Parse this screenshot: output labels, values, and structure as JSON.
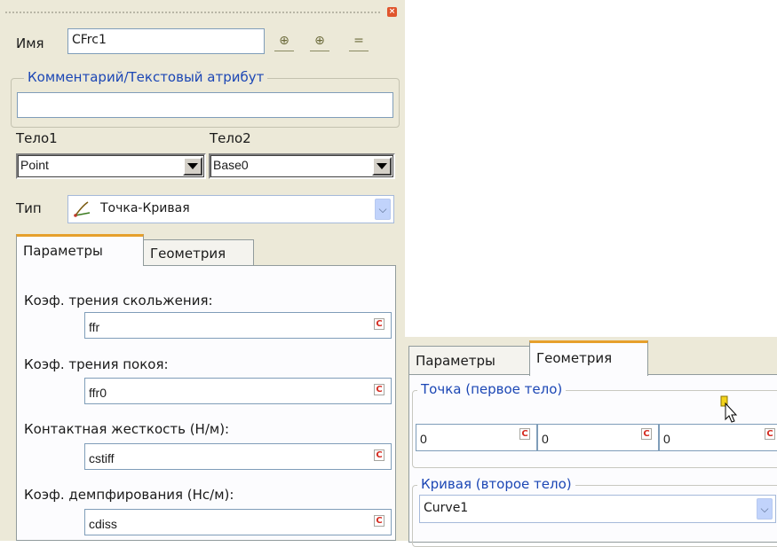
{
  "left": {
    "name_label": "Имя",
    "name_value": "CFrc1",
    "toolbar": [
      "-1-",
      "-1-",
      "-1-"
    ],
    "comment_group": "Комментарий/Текстовый атрибут",
    "comment_value": "",
    "body1_label": "Тело1",
    "body2_label": "Тело2",
    "body1_value": "Point",
    "body2_value": "Base0",
    "type_label": "Тип",
    "type_value": "Точка-Кривая",
    "tabs": {
      "params": "Параметры",
      "geometry": "Геометрия"
    },
    "fields": [
      {
        "label": "Коэф. трения скольжения:",
        "value": "ffr",
        "c": "C"
      },
      {
        "label": "Коэф. трения покоя:",
        "value": "ffr0",
        "c": "C"
      },
      {
        "label": "Контактная жесткость (Н/м):",
        "value": "cstiff",
        "c": "C"
      },
      {
        "label": "Коэф. демпфирования (Нс/м):",
        "value": "cdiss",
        "c": "C"
      }
    ]
  },
  "right": {
    "tabs": {
      "params": "Параметры",
      "geometry": "Геометрия"
    },
    "point_group": "Точка (первое тело)",
    "coords": [
      "0",
      "0",
      "0"
    ],
    "c": "C",
    "curve_group": "Кривая (второе тело)",
    "curve_value": "Curve1"
  },
  "colors": {
    "accent_tab": "#e6a02c",
    "group_title": "#1c47b5",
    "c_button": "#d42a1f"
  }
}
